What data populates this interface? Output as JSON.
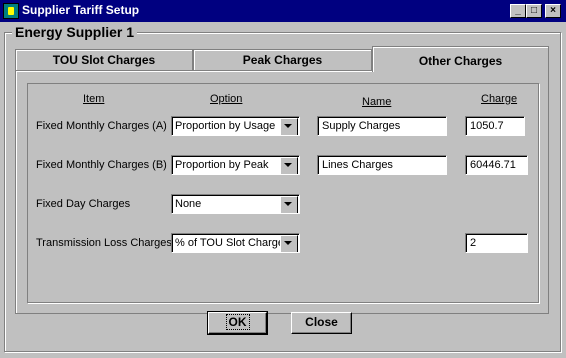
{
  "window": {
    "title": "Supplier Tariff Setup",
    "minimize": "_",
    "maximize": "□",
    "close": "×"
  },
  "group_title": "Energy Supplier 1",
  "tabs": [
    {
      "label": "TOU Slot Charges"
    },
    {
      "label": "Peak Charges"
    },
    {
      "label": "Other Charges"
    }
  ],
  "headers": {
    "item": "Item",
    "option": "Option",
    "name": "Name",
    "charge": "Charge"
  },
  "rows": [
    {
      "item": "Fixed Monthly Charges (A)",
      "option": "Proportion by Usage",
      "name": "Supply Charges",
      "charge": "1050.7"
    },
    {
      "item": "Fixed Monthly Charges (B)",
      "option": "Proportion by Peak",
      "name": "Lines Charges",
      "charge": "60446.71"
    },
    {
      "item": "Fixed Day Charges",
      "option": "None",
      "name": "",
      "charge": ""
    },
    {
      "item": "Transmission Loss Charges",
      "option": "% of TOU Slot Charges",
      "name": "",
      "charge": "2"
    }
  ],
  "buttons": {
    "ok": "OK",
    "close": "Close"
  }
}
